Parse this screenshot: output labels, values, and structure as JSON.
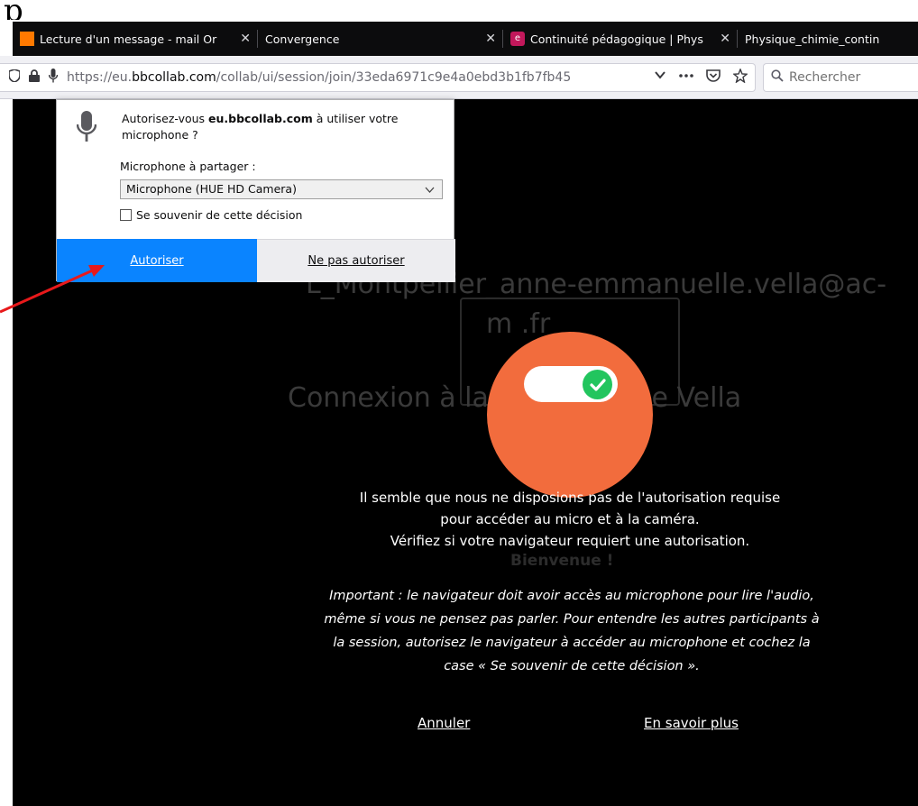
{
  "corner_text": "p",
  "tabs": [
    {
      "title": "Lecture d'un message - mail Or",
      "close": "✕",
      "favicon": "orange-logo-icon"
    },
    {
      "title": "Convergence",
      "close": "✕",
      "favicon": ""
    },
    {
      "title": "Continuité pédagogique | Phys",
      "close": "✕",
      "favicon": "e-logo-icon"
    },
    {
      "title": "Physique_chimie_contin",
      "close": "",
      "favicon": ""
    }
  ],
  "nav": {
    "url_prefix": "https://eu.",
    "url_domain": "bbcollab.com",
    "url_path": "/collab/ui/session/join/33eda6971c9e4a0ebd3b1fb7fb45",
    "search_placeholder": "Rechercher"
  },
  "popup": {
    "question_prefix": "Autorisez-vous ",
    "question_domain": "eu.bbcollab.com",
    "question_suffix": " à utiliser votre microphone ?",
    "share_label": "Microphone à partager :",
    "selected_device": "Microphone (HUE HD Camera)",
    "remember_label": "Se souvenir de cette décision",
    "allow_label": "Autoriser",
    "deny_label": "Ne pas autoriser"
  },
  "background": {
    "user_line1": "L_Montpellier_anne-emmanuelle.vella@ac-",
    "user_line2": "m                    .fr",
    "connecting": "Connexion à la s                        t que Anne Vella",
    "welcome": "Bienvenue !"
  },
  "message": {
    "line1": "Il semble que nous ne disposions pas de l'autorisation requise",
    "line2": "pour accéder au micro et à la caméra.",
    "line3": "Vérifiez si votre navigateur requiert une autorisation.",
    "note": "Important : le navigateur doit avoir accès au microphone pour lire l'audio, même si vous ne pensez pas parler. Pour entendre les autres participants à la session, autorisez le navigateur à accéder au microphone et cochez la case « Se souvenir de cette décision ».",
    "cancel_label": "Annuler",
    "learn_more_label": "En savoir plus"
  },
  "colors": {
    "allow_button": "#0a84ff",
    "badge_circle": "#f26c3d",
    "check_knob": "#22c55e",
    "arrow": "#e8191b"
  }
}
